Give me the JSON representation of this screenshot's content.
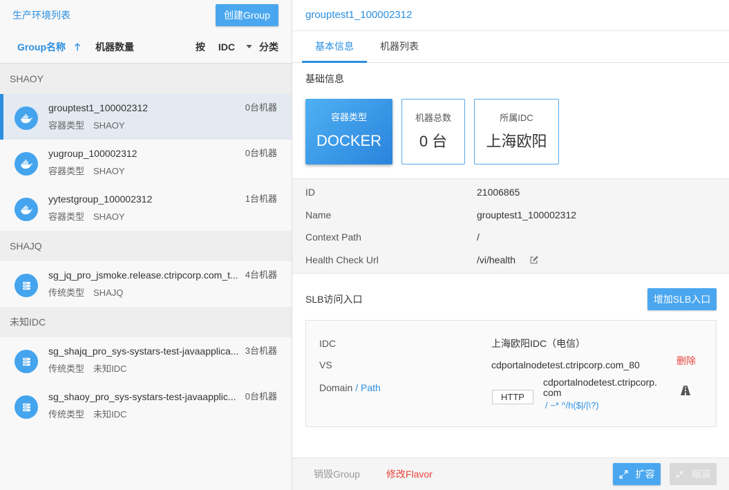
{
  "theme": {
    "accent": "#2b8fe0",
    "accent_light": "#4aa7ef",
    "danger": "#e8453c",
    "selected_bg": "#e4eaf2"
  },
  "left": {
    "title": "生产环境列表",
    "create_button": "创建Group",
    "columns": {
      "group_name": "Group名称",
      "sort_icon": "sort-ascending-icon",
      "machine_count": "机器数量",
      "group_by_prefix": "按",
      "group_by_value": "IDC",
      "group_by_suffix": "分类"
    },
    "groups": [
      {
        "idc": "SHAOY",
        "items": [
          {
            "name": "grouptest1_100002312",
            "type": "容器类型",
            "idc": "SHAOY",
            "count": "0台机器",
            "icon": "docker-icon",
            "selected": true
          },
          {
            "name": "yugroup_100002312",
            "type": "容器类型",
            "idc": "SHAOY",
            "count": "0台机器",
            "icon": "docker-icon",
            "selected": false
          },
          {
            "name": "yytestgroup_100002312",
            "type": "容器类型",
            "idc": "SHAOY",
            "count": "1台机器",
            "icon": "docker-icon",
            "selected": false
          }
        ]
      },
      {
        "idc": "SHAJQ",
        "items": [
          {
            "name": "sg_jq_pro_jsmoke.release.ctripcorp.com_t...",
            "type": "传统类型",
            "idc": "SHAJQ",
            "count": "4台机器",
            "icon": "server-icon",
            "selected": false
          }
        ]
      },
      {
        "idc": "未知IDC",
        "items": [
          {
            "name": "sg_shajq_pro_sys-systars-test-javaapplica...",
            "type": "传统类型",
            "idc": "未知IDC",
            "count": "3台机器",
            "icon": "server-icon",
            "selected": false
          },
          {
            "name": "sg_shaoy_pro_sys-systars-test-javaapplic...",
            "type": "传统类型",
            "idc": "未知IDC",
            "count": "0台机器",
            "icon": "server-icon",
            "selected": false
          }
        ]
      }
    ]
  },
  "detail": {
    "title": "grouptest1_100002312",
    "tabs": [
      {
        "label": "基本信息",
        "active": true
      },
      {
        "label": "机器列表",
        "active": false
      }
    ],
    "basic_title": "基础信息",
    "cards": [
      {
        "label": "容器类型",
        "value": "DOCKER",
        "highlight": true
      },
      {
        "label": "机器总数",
        "value": "0 台",
        "highlight": false
      },
      {
        "label": "所属IDC",
        "value": "上海欧阳",
        "highlight": false
      }
    ],
    "info_rows": [
      {
        "label": "ID",
        "value": "21006865"
      },
      {
        "label": "Name",
        "value": "grouptest1_100002312"
      },
      {
        "label": "Context Path",
        "value": "/"
      },
      {
        "label": "Health Check Url",
        "value": "/vi/health",
        "icon": "edit-icon"
      }
    ],
    "slb": {
      "title": "SLB访问入口",
      "add_button": "增加SLB入口",
      "entries": [
        {
          "idc_label": "IDC",
          "idc_value": "上海欧阳IDC（电信）",
          "vs_label": "VS",
          "vs_value": "cdportalnodetest.ctripcorp.com_80",
          "delete_label": "删除",
          "domain_label": "Domain",
          "path_label": "/ Path",
          "protocol": "HTTP",
          "domain_value": "cdportalnodetest.ctripcorp.com",
          "path_value": "/ ~* ^/h($|/|\\?)",
          "action_icon": "road-icon"
        }
      ]
    }
  },
  "footer": {
    "destroy": "销毁Group",
    "modify_flavor": "修改Flavor",
    "scale_out": "扩容",
    "scale_out_icon": "expand-icon",
    "scale_in": "缩容",
    "scale_in_icon": "compress-icon",
    "scale_in_disabled": true
  }
}
